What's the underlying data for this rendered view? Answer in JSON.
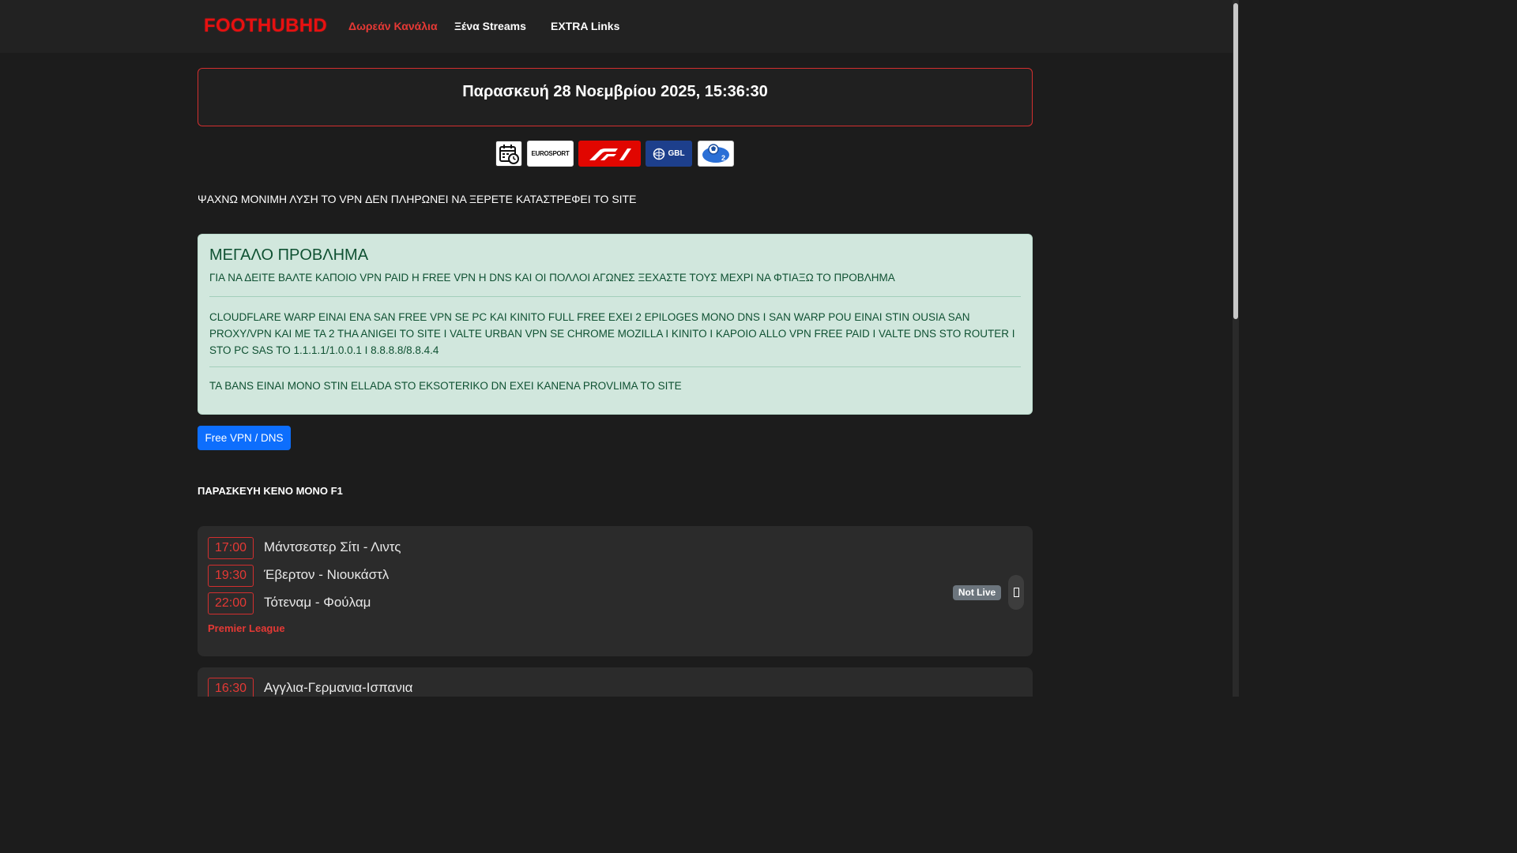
{
  "nav": {
    "brand": "FOOTHUBHD",
    "links": [
      "Δωρεάν Κανάλια",
      "Ξένα Streams",
      "EXTRA Links"
    ]
  },
  "datetime": "Παρασκευή 28 Νοεμβρίου 2025, 15:36:30",
  "channels": {
    "eurosport": "EUROSPORT",
    "gbl": "GBL"
  },
  "vpn_note": "ΨΑΧΝΩ ΜΟΝΙΜΗ ΛΥΣΗ ΤΟ VPN ΔΕΝ ΠΛΗΡΩΝΕΙ ΝΑ ΞΕΡΕΤΕ ΚΑΤΑΣΤΡΕΦΕΙ ΤΟ SITE",
  "alert": {
    "title": "ΜΕΓΑΛΟ ΠΡΟΒΛΗΜΑ",
    "p1": "ΓΙΑ ΝΑ ΔΕΙΤΕ ΒΑΛΤΕ ΚΑΠΟΙΟ VPN PAID Η FREE VPN Η DNS ΚΑΙ ΟΙ ΠΟΛΛΟΙ ΑΓΩΝΕΣ ΞΕΧΑΣΤΕ ΤΟΥΣ ΜΕΧΡΙ ΝΑ ΦΤΙΑΞΩ ΤΟ ΠΡΟΒΛΗΜΑ",
    "p2": "CLOUDFLARE WARP EINAI ENA SAN FREE VPN SE PC KAI KINITO FULL FREE EXEI 2 EPILOGES MONO DNS I SAN WARP POU EINAI STIN OUSIA SAN PROXY/VPN KAI ME TA 2 THA ANIGEI TO SITE I VALTE URBAN VPN SE CHROME MOZILLA I KINITO I KAPOIO ALLO VPN FREE PAID I VALTE DNS STO ROUTER I STO PC SAS TO 1.1.1.1/1.0.0.1 I 8.8.8.8/8.8.4.4",
    "p3": "TA BANS EINAI MONO STIN ELLADA STO EKSOTERIKO DN EXEI KANENA PROVLIMA TO SITE"
  },
  "vpn_button": "Free VPN / DNS",
  "day_heading": "ΠΑΡΑΣΚΕΥΗ ΚΕΝΟ ΜΟΝΟ F1",
  "matches": [
    {
      "rows": [
        {
          "time": "17:00",
          "name": "Μάντσεστερ Σίτι - Λιντς"
        },
        {
          "time": "19:30",
          "name": "Έβερτον - Νιουκάστλ"
        },
        {
          "time": "22:00",
          "name": "Τότεναμ - Φούλαμ"
        }
      ],
      "league": "Premier League",
      "status": "Not Live"
    },
    {
      "rows": [
        {
          "time": "16:30",
          "name": "Αγγλια-Γερμανια-Ισπανια"
        }
      ]
    }
  ],
  "colors": {
    "brand": "#e81010",
    "accent_red": "#e53935",
    "button_blue": "#0d6efd",
    "alert_bg": "#d1e7dd",
    "alert_text": "#0f5132"
  }
}
